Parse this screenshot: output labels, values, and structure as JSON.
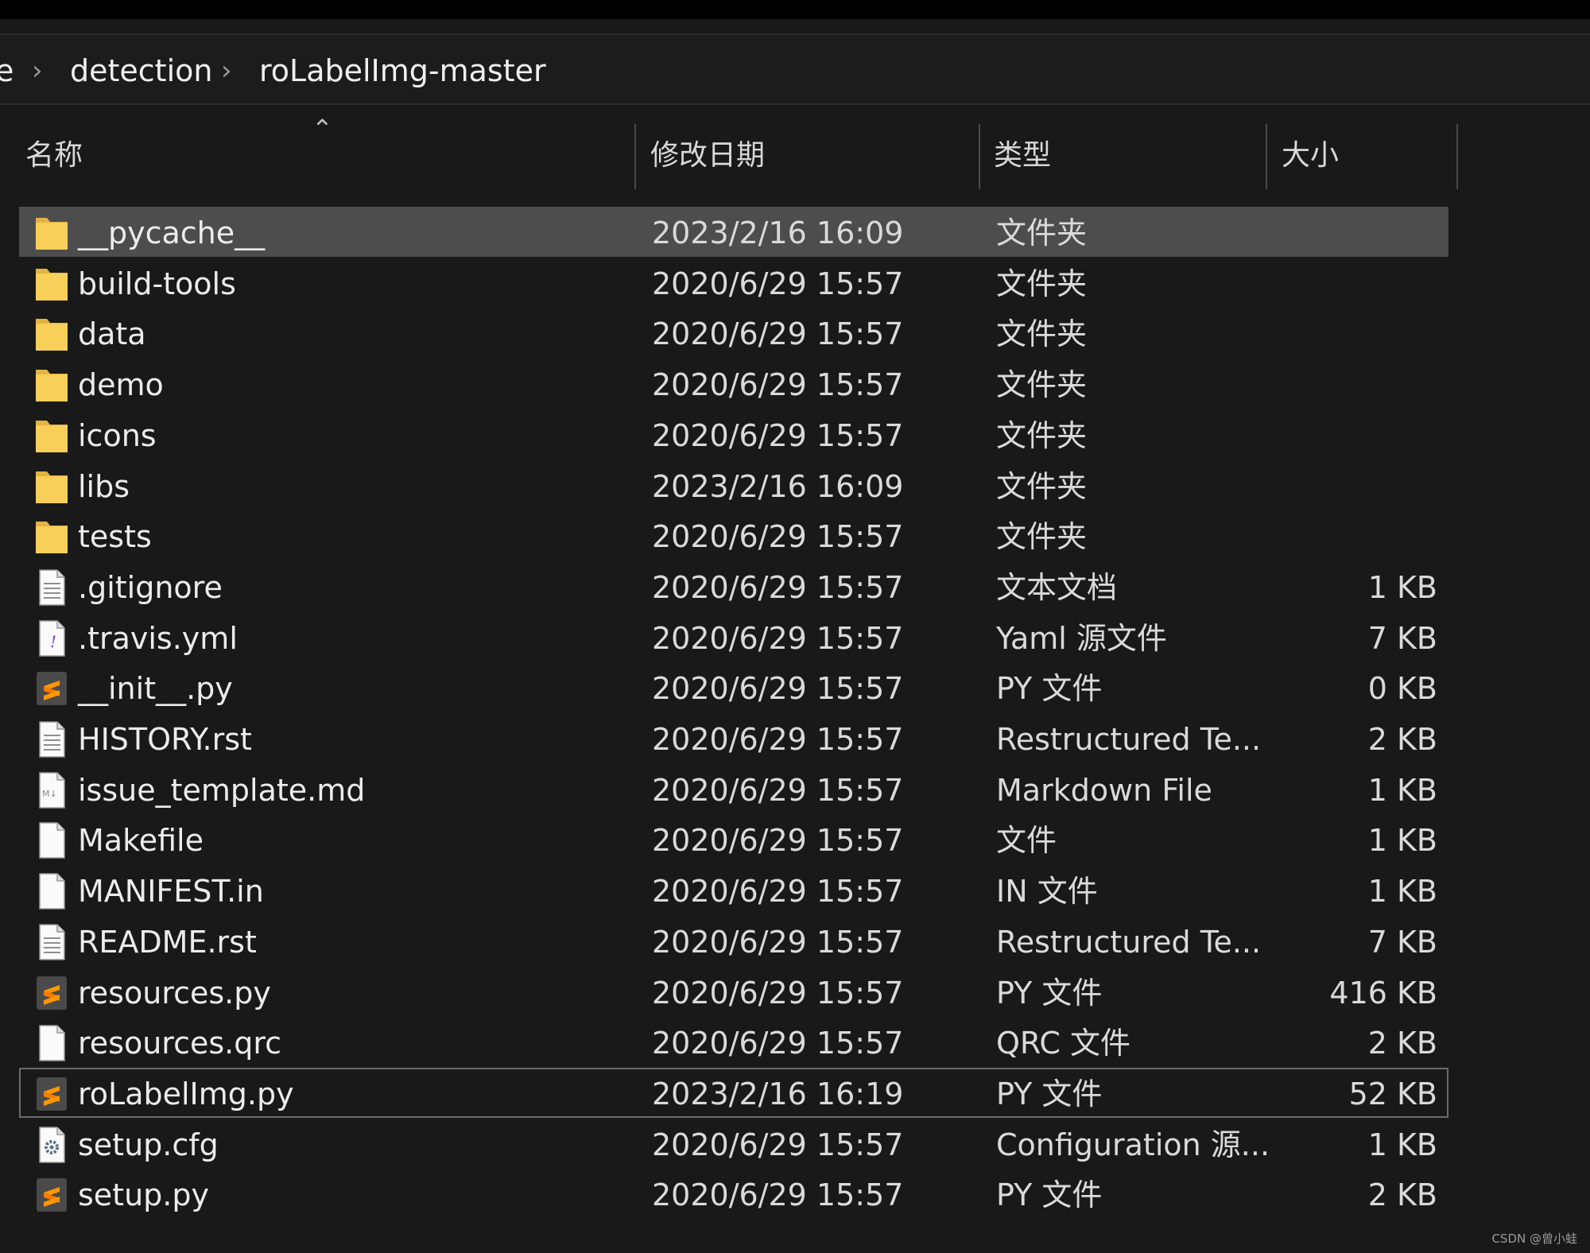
{
  "breadcrumb": [
    "e",
    "detection",
    "roLabelImg-master"
  ],
  "columns": {
    "name": "名称",
    "date": "修改日期",
    "type": "类型",
    "size": "大小"
  },
  "sort_icon": "chevron-up-icon",
  "files": [
    {
      "name": "__pycache__",
      "date": "2023/2/16 16:09",
      "type": "文件夹",
      "size": "",
      "icon": "folder-icon",
      "state": "selected"
    },
    {
      "name": "build-tools",
      "date": "2020/6/29 15:57",
      "type": "文件夹",
      "size": "",
      "icon": "folder-icon"
    },
    {
      "name": "data",
      "date": "2020/6/29 15:57",
      "type": "文件夹",
      "size": "",
      "icon": "folder-icon"
    },
    {
      "name": "demo",
      "date": "2020/6/29 15:57",
      "type": "文件夹",
      "size": "",
      "icon": "folder-icon"
    },
    {
      "name": "icons",
      "date": "2020/6/29 15:57",
      "type": "文件夹",
      "size": "",
      "icon": "folder-icon"
    },
    {
      "name": "libs",
      "date": "2023/2/16 16:09",
      "type": "文件夹",
      "size": "",
      "icon": "folder-icon"
    },
    {
      "name": "tests",
      "date": "2020/6/29 15:57",
      "type": "文件夹",
      "size": "",
      "icon": "folder-icon"
    },
    {
      "name": ".gitignore",
      "date": "2020/6/29 15:57",
      "type": "文本文档",
      "size": "1 KB",
      "icon": "text-file-icon"
    },
    {
      "name": ".travis.yml",
      "date": "2020/6/29 15:57",
      "type": "Yaml 源文件",
      "size": "7 KB",
      "icon": "yaml-file-icon"
    },
    {
      "name": "__init__.py",
      "date": "2020/6/29 15:57",
      "type": "PY 文件",
      "size": "0 KB",
      "icon": "sublime-file-icon"
    },
    {
      "name": "HISTORY.rst",
      "date": "2020/6/29 15:57",
      "type": "Restructured Te...",
      "size": "2 KB",
      "icon": "text-file-icon"
    },
    {
      "name": "issue_template.md",
      "date": "2020/6/29 15:57",
      "type": "Markdown File",
      "size": "1 KB",
      "icon": "markdown-file-icon"
    },
    {
      "name": "Makefile",
      "date": "2020/6/29 15:57",
      "type": "文件",
      "size": "1 KB",
      "icon": "blank-file-icon"
    },
    {
      "name": "MANIFEST.in",
      "date": "2020/6/29 15:57",
      "type": "IN 文件",
      "size": "1 KB",
      "icon": "blank-file-icon"
    },
    {
      "name": "README.rst",
      "date": "2020/6/29 15:57",
      "type": "Restructured Te...",
      "size": "7 KB",
      "icon": "text-file-icon"
    },
    {
      "name": "resources.py",
      "date": "2020/6/29 15:57",
      "type": "PY 文件",
      "size": "416 KB",
      "icon": "sublime-file-icon"
    },
    {
      "name": "resources.qrc",
      "date": "2020/6/29 15:57",
      "type": "QRC 文件",
      "size": "2 KB",
      "icon": "blank-file-icon"
    },
    {
      "name": "roLabelImg.py",
      "date": "2023/2/16 16:19",
      "type": "PY 文件",
      "size": "52 KB",
      "icon": "sublime-file-icon",
      "state": "focused"
    },
    {
      "name": "setup.cfg",
      "date": "2020/6/29 15:57",
      "type": "Configuration 源...",
      "size": "1 KB",
      "icon": "config-file-icon"
    },
    {
      "name": "setup.py",
      "date": "2020/6/29 15:57",
      "type": "PY 文件",
      "size": "2 KB",
      "icon": "sublime-file-icon"
    }
  ],
  "watermark": "CSDN @曾小蛙"
}
